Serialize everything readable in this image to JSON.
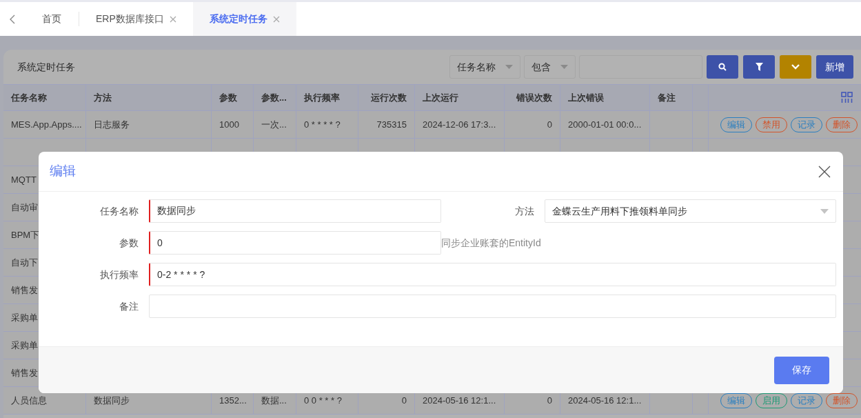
{
  "tabs": [
    {
      "label": "首页",
      "closable": false,
      "selected": false
    },
    {
      "label": "ERP数据库接口",
      "closable": true,
      "selected": false
    },
    {
      "label": "系统定时任务",
      "closable": true,
      "selected": true
    }
  ],
  "panel": {
    "title": "系统定时任务",
    "filters": [
      {
        "kind": "select",
        "value": "任务名称"
      },
      {
        "kind": "select",
        "value": "包含"
      },
      {
        "kind": "input"
      }
    ],
    "buttons": [
      {
        "kind": "search"
      },
      {
        "kind": "filter"
      },
      {
        "kind": "expand"
      },
      {
        "kind": "text",
        "label": "新增"
      }
    ]
  },
  "table": {
    "columns": [
      {
        "label": "任务名称"
      },
      {
        "label": "方法"
      },
      {
        "label": "参数"
      },
      {
        "label": "参数..."
      },
      {
        "label": "执行频率"
      },
      {
        "label": "运行次数"
      },
      {
        "label": "上次运行"
      },
      {
        "label": "错误次数"
      },
      {
        "label": "上次错误"
      },
      {
        "label": "备注"
      }
    ],
    "rows": [
      {
        "cells": [
          "MES.App.Apps....",
          "日志服务",
          "1000",
          "一次...",
          "0 * * * * ?",
          "735315",
          "2024-12-06 17:3...",
          "0",
          "2000-01-01 00:0..."
        ],
        "actions": [
          {
            "kind": "edit",
            "label": "编辑"
          },
          {
            "kind": "disable",
            "label": "禁用"
          },
          {
            "kind": "log",
            "label": "记录"
          },
          {
            "kind": "delete",
            "label": "删除"
          }
        ]
      },
      {
        "cells": []
      },
      {
        "cells": [
          "MQTT"
        ]
      },
      {
        "cells": [
          "自动审"
        ]
      },
      {
        "cells": [
          "BPM下"
        ]
      },
      {
        "cells": [
          "自动下"
        ]
      },
      {
        "cells": [
          "销售发"
        ]
      },
      {
        "cells": [
          "采购单"
        ]
      },
      {
        "cells": [
          "采购单"
        ]
      },
      {
        "cells": [
          "销售发"
        ]
      },
      {
        "cells": [
          "人员信息",
          "数据同步",
          "1352...",
          "数据...",
          "0 0 * * * ?",
          "0",
          "2024-05-16 12:1...",
          "0",
          "2024-05-16 12:1..."
        ],
        "actions": [
          {
            "kind": "edit",
            "label": "编辑"
          },
          {
            "kind": "enable",
            "label": "启用"
          },
          {
            "kind": "log",
            "label": "记录"
          },
          {
            "kind": "delete",
            "label": "删除"
          }
        ]
      }
    ]
  },
  "dialog": {
    "title": "编辑",
    "form_rows": [
      [
        {
          "kind": "input",
          "label": "任务名称",
          "value": "数据同步",
          "required": true
        },
        {
          "kind": "select",
          "label": "方法",
          "value": "金蝶云生产用料下推领料单同步",
          "required": false
        }
      ],
      [
        {
          "kind": "input",
          "label": "参数",
          "value": "0",
          "required": true,
          "hint": "同步企业账套的EntityId"
        }
      ],
      [
        {
          "kind": "input",
          "label": "执行频率",
          "value": "0-2 * * * * ?",
          "required": true
        }
      ],
      [
        {
          "kind": "input",
          "label": "备注",
          "required": false
        }
      ]
    ],
    "save_button": "保存"
  }
}
